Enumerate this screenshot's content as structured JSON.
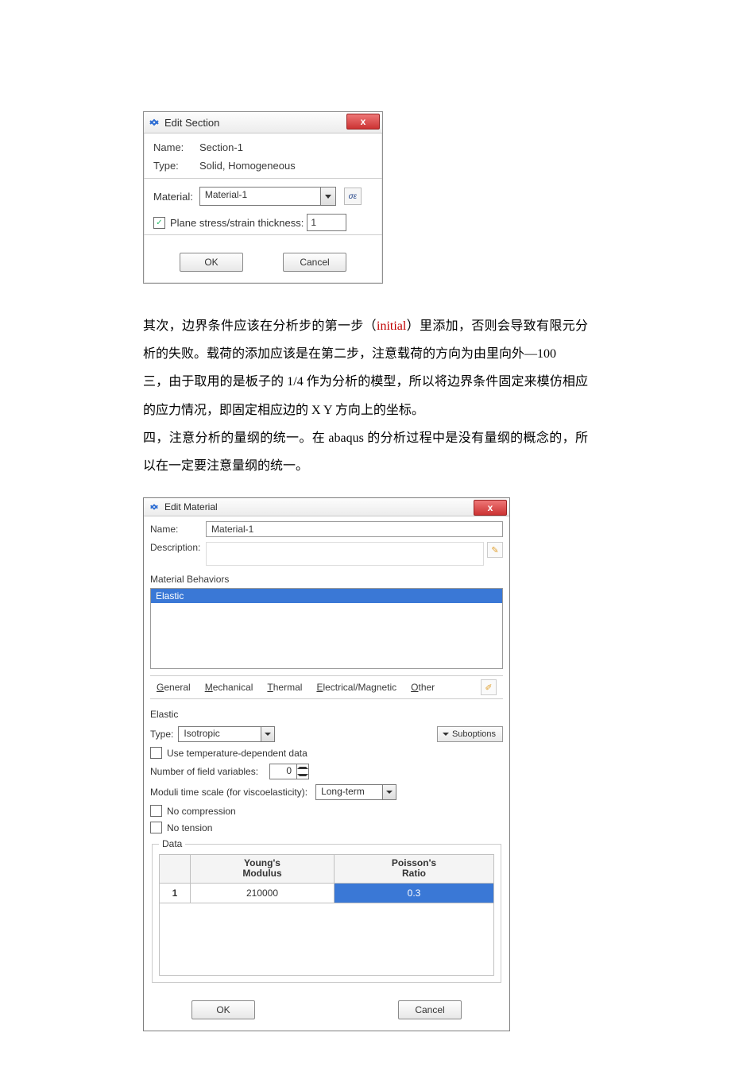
{
  "section_dialog": {
    "title": "Edit Section",
    "name_label": "Name:",
    "name_value": "Section-1",
    "type_label": "Type:",
    "type_value": "Solid, Homogeneous",
    "material_label": "Material:",
    "material_value": "Material-1",
    "plane_checked": true,
    "plane_label": "Plane stress/strain thickness:",
    "plane_value": "1",
    "ok": "OK",
    "cancel": "Cancel"
  },
  "paragraph": {
    "p1a": "其次，边界条件应该在分析步的第一步（",
    "p1_initial": "initial",
    "p1b": "）里添加，否则会导致有限元分析的失败。载荷的添加应该是在第二步，注意载荷的方向为由里向外—100",
    "p2": "三，由于取用的是板子的 1/4 作为分析的模型，所以将边界条件固定来模仿相应的应力情况，即固定相应边的 X Y 方向上的坐标。",
    "p3": "四，注意分析的量纲的统一。在 abaqus 的分析过程中是没有量纲的概念的，所以在一定要注意量纲的统一。"
  },
  "material_dialog": {
    "title": "Edit Material",
    "name_label": "Name:",
    "name_value": "Material-1",
    "desc_label": "Description:",
    "behav_label": "Material Behaviors",
    "behav_selected": "Elastic",
    "menu": {
      "general": "General",
      "mechanical": "Mechanical",
      "thermal": "Thermal",
      "em": "Electrical/Magnetic",
      "other": "Other"
    },
    "elastic_head": "Elastic",
    "type_label": "Type:",
    "type_value": "Isotropic",
    "suboptions": "Suboptions",
    "use_temp_label": "Use temperature-dependent data",
    "use_temp_checked": false,
    "nfv_label": "Number of field variables:",
    "nfv_value": "0",
    "moduli_label": "Moduli time scale (for viscoelasticity):",
    "moduli_value": "Long-term",
    "no_comp": "No compression",
    "no_comp_checked": false,
    "no_tens": "No tension",
    "no_tens_checked": false,
    "data_legend": "Data",
    "col1a": "Young's",
    "col1b": "Modulus",
    "col2a": "Poisson's",
    "col2b": "Ratio",
    "row_num": "1",
    "youngs": "210000",
    "poisson": "0.3",
    "ok": "OK",
    "cancel": "Cancel"
  }
}
